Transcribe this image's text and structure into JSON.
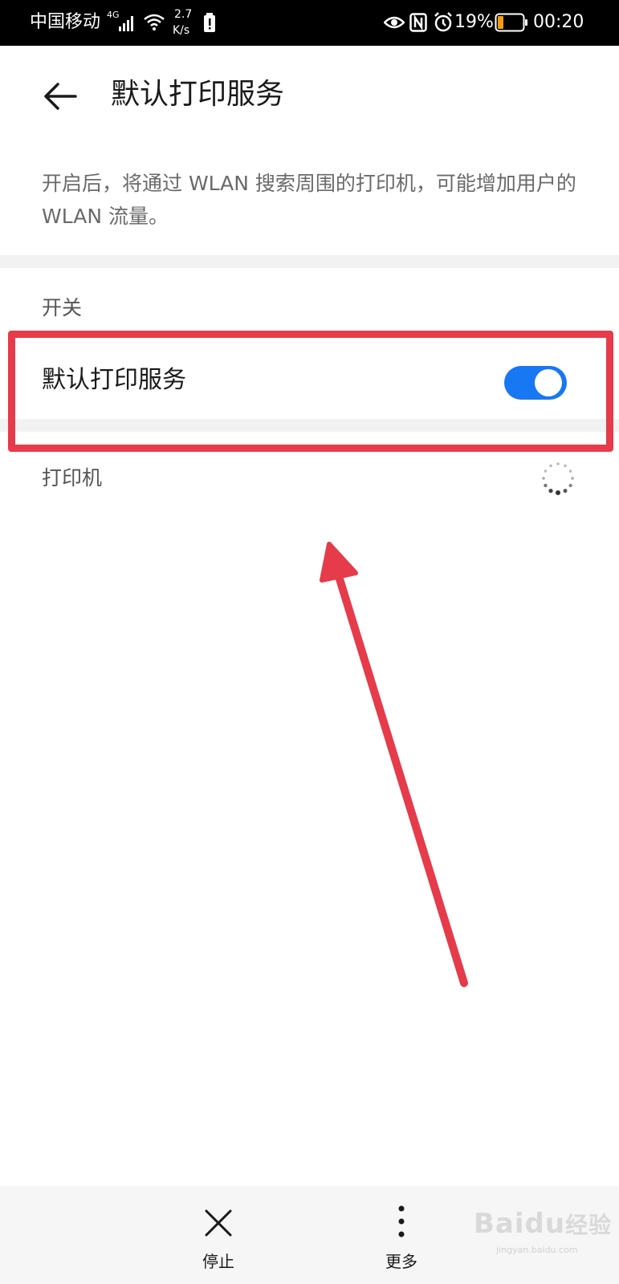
{
  "status_bar": {
    "carrier": "中国移动",
    "network_type": "4G",
    "speed_value": "2.7",
    "speed_unit": "K/s",
    "battery_percent": "19%",
    "time": "00:20",
    "icons": [
      "signal-icon",
      "wifi-icon",
      "notification-icon",
      "eye-icon",
      "nfc-icon",
      "alarm-icon",
      "battery-icon"
    ]
  },
  "header": {
    "title": "默认打印服务",
    "back_icon": "arrow-left-icon"
  },
  "description": "开启后，将通过 WLAN 搜索周围的打印机，可能增加用户的 WLAN 流量。",
  "switch_section": {
    "label": "开关",
    "row_label": "默认打印服务",
    "toggle_on": true,
    "accent_color": "#1877f2"
  },
  "printers_section": {
    "label": "打印机",
    "loading_icon": "spinner-icon"
  },
  "bottom_bar": {
    "stop_label": "停止",
    "more_label": "更多"
  },
  "annotation": {
    "color": "#e63b4a"
  },
  "watermark": {
    "brand": "Baidu",
    "brand_cn": "经验",
    "url": "jingyan.baidu.com"
  }
}
